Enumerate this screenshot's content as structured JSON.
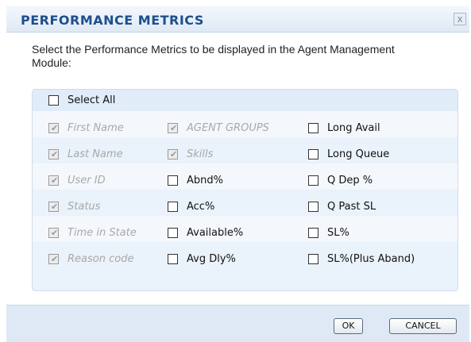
{
  "dialog": {
    "title": "PERFORMANCE METRICS",
    "close_label": "x",
    "instruction": "Select the Performance Metrics to be displayed in the Agent Management Module:"
  },
  "select_all": {
    "label": "Select All",
    "checked": false
  },
  "metrics": {
    "col1": [
      {
        "label": "First Name",
        "checked": true,
        "disabled": true
      },
      {
        "label": "Last Name",
        "checked": true,
        "disabled": true
      },
      {
        "label": "User ID",
        "checked": true,
        "disabled": true
      },
      {
        "label": "Status",
        "checked": true,
        "disabled": true
      },
      {
        "label": "Time in State",
        "checked": true,
        "disabled": true
      },
      {
        "label": "Reason code",
        "checked": true,
        "disabled": true
      }
    ],
    "col2": [
      {
        "label": "AGENT GROUPS",
        "checked": true,
        "disabled": true
      },
      {
        "label": "Skills",
        "checked": true,
        "disabled": true
      },
      {
        "label": "Abnd%",
        "checked": false,
        "disabled": false
      },
      {
        "label": "Acc%",
        "checked": false,
        "disabled": false
      },
      {
        "label": "Available%",
        "checked": false,
        "disabled": false
      },
      {
        "label": "Avg Dly%",
        "checked": false,
        "disabled": false
      }
    ],
    "col3": [
      {
        "label": "Long Avail",
        "checked": false,
        "disabled": false
      },
      {
        "label": "Long Queue",
        "checked": false,
        "disabled": false
      },
      {
        "label": "Q Dep %",
        "checked": false,
        "disabled": false
      },
      {
        "label": "Q Past SL",
        "checked": false,
        "disabled": false
      },
      {
        "label": "SL%",
        "checked": false,
        "disabled": false
      },
      {
        "label": "SL%(Plus Aband)",
        "checked": false,
        "disabled": false
      }
    ]
  },
  "buttons": {
    "ok_label": "OK",
    "cancel_label": "CANCEL"
  },
  "colors": {
    "title": "#1e4f8c",
    "panel": "#eaf2fb",
    "footer": "#dfe9f5"
  }
}
